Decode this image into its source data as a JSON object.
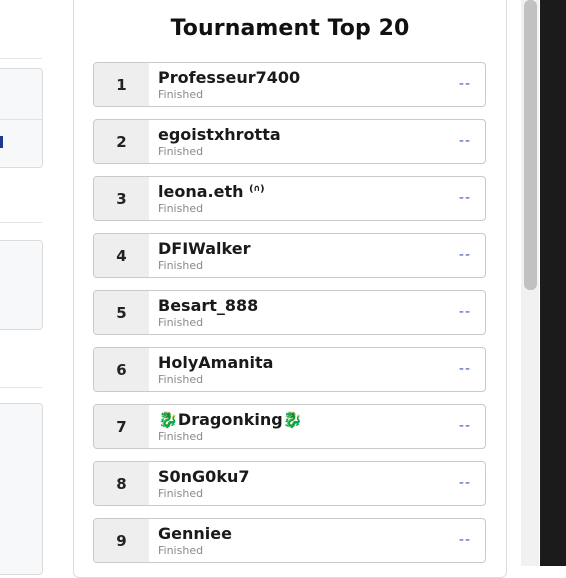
{
  "leaderboard": {
    "title": "Tournament Top 20",
    "rows": [
      {
        "rank": "1",
        "name": "Professeur7400",
        "status": "Finished",
        "score": "--"
      },
      {
        "rank": "2",
        "name": "egoistxhrotta",
        "status": "Finished",
        "score": "--"
      },
      {
        "rank": "3",
        "name": "leona.eth ⁽ᐢ⁾",
        "status": "Finished",
        "score": "--"
      },
      {
        "rank": "4",
        "name": "DFIWalker",
        "status": "Finished",
        "score": "--"
      },
      {
        "rank": "5",
        "name": "Besart_888",
        "status": "Finished",
        "score": "--"
      },
      {
        "rank": "6",
        "name": "HolyAmanita",
        "status": "Finished",
        "score": "--"
      },
      {
        "rank": "7",
        "name": "🐉Dragonking🐉",
        "status": "Finished",
        "score": "--"
      },
      {
        "rank": "8",
        "name": "S0nG0ku7",
        "status": "Finished",
        "score": "--"
      },
      {
        "rank": "9",
        "name": "Genniee",
        "status": "Finished",
        "score": "--"
      }
    ]
  },
  "colors": {
    "accent": "#3a56c9",
    "rank_bg": "#eeeeee",
    "border": "#c9c9c9"
  }
}
